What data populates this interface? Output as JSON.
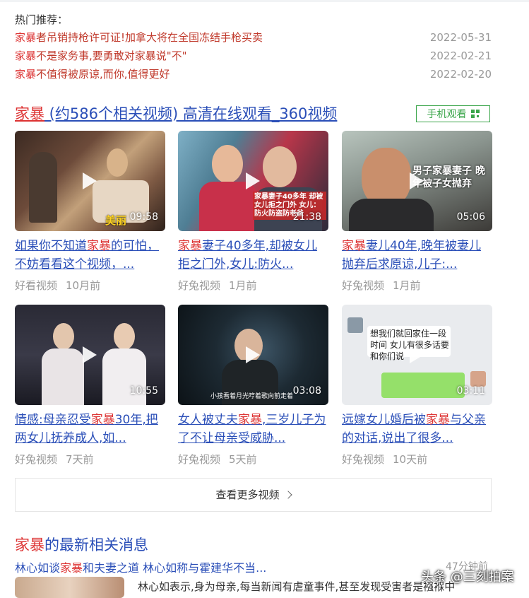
{
  "hot": {
    "title": "热门推荐：",
    "items": [
      {
        "kw": "家暴",
        "rest": "者吊销持枪许可证!加拿大将在全国冻结手枪买卖",
        "date": "2022-05-31"
      },
      {
        "kw": "家暴",
        "rest": "不是家务事,要勇敢对家暴说\"不\"",
        "date": "2022-02-21"
      },
      {
        "kw": "家暴",
        "rest": "不值得被原谅,而你,值得更好",
        "date": "2022-02-20"
      }
    ]
  },
  "video_section": {
    "title_kw": "家暴",
    "title_rest": " (约586个相关视频) 高清在线观看_360视频",
    "mobile_label": "手机观看",
    "more_label": "查看更多视频",
    "videos": [
      {
        "kw_prefix": "",
        "pre": "如果你不知道",
        "kw": "家暴",
        "post": "的可怕，不妨看看这个视频，...",
        "duration": "09:58",
        "source": "好看视频",
        "time": "10月前",
        "overlay": "美丽"
      },
      {
        "kw_prefix": "",
        "pre": "",
        "kw": "家暴",
        "post": "妻子40多年,却被女儿拒之门外,女儿:防火...",
        "duration": "21:38",
        "source": "好兔视频",
        "time": "1月前",
        "overlay": "家暴妻子40多年 却被女儿拒之门外 女儿：防火防盗防老爸"
      },
      {
        "kw_prefix": "",
        "pre": "",
        "kw": "家暴",
        "post": "妻儿40年,晚年被妻儿抛弃后求原谅,儿子:...",
        "duration": "05:06",
        "source": "好兔视频",
        "time": "1月前",
        "overlay": "男子家暴妻子 晚年被子女抛弃"
      },
      {
        "kw_prefix": "",
        "pre": "情感:母亲忍受",
        "kw": "家暴",
        "post": "30年,把两女儿抚养成人,如...",
        "duration": "10:55",
        "source": "好兔视频",
        "time": "7天前",
        "overlay": ""
      },
      {
        "kw_prefix": "",
        "pre": "女人被丈夫",
        "kw": "家暴",
        "post": ",三岁儿子为了不让母亲受威胁...",
        "duration": "03:08",
        "source": "好兔视频",
        "time": "5天前",
        "overlay": "小孩看着月光哼着歌向前走着"
      },
      {
        "kw_prefix": "",
        "pre": "远嫁女儿婚后被",
        "kw": "家暴",
        "post": "与父亲的对话,说出了很多...",
        "duration": "03:11",
        "source": "好兔视频",
        "time": "10天前",
        "overlay": "想我们就回家住一段时间 女儿有很多话要和你们说"
      }
    ]
  },
  "news": {
    "title_kw": "家暴",
    "title_rest": "的最新相关消息",
    "link_pre": "林心如谈",
    "link_kw": "家暴",
    "link_post": "和夫妻之道 林心如称与霍建华不当...",
    "time": "47分钟前",
    "snippet": "林心如表示,身为母亲,每当新闻有虐童事件,甚至发现受害者是襁褓中"
  },
  "watermark": "头条 @三刻拍案"
}
